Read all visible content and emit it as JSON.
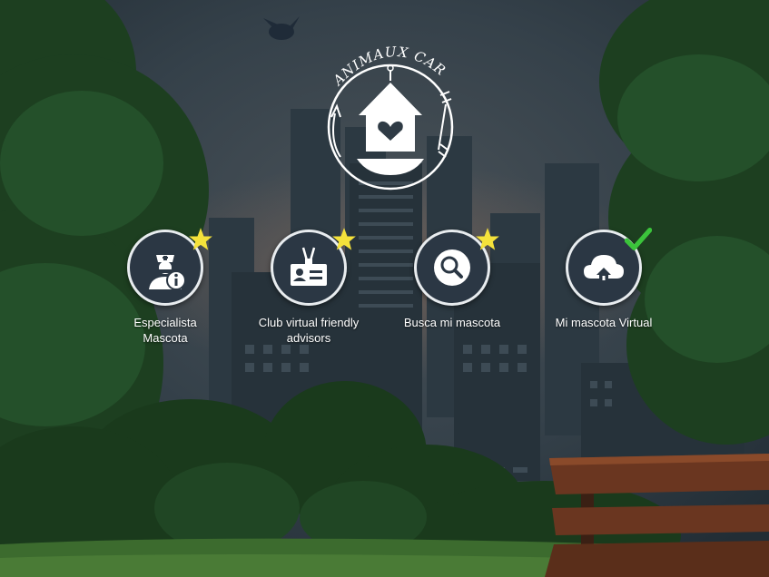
{
  "app": {
    "brand_name": "ANIMAUX CARES",
    "accent_colors": {
      "sky": "#2f3b45",
      "foliage": "#1f4a24",
      "icon_circle": "#2b3744",
      "star": "#f5e23b",
      "check": "#3bc43b"
    }
  },
  "menu": [
    {
      "label": "Especialista\nMascota",
      "icon": "vet-info-icon",
      "badge": "star-icon"
    },
    {
      "label": "Club virtual friendly\nadvisors",
      "icon": "id-card-icon",
      "badge": "star-icon"
    },
    {
      "label": "Busca mi mascota",
      "icon": "search-icon",
      "badge": "star-icon"
    },
    {
      "label": "Mi mascota Virtual",
      "icon": "cloud-home-icon",
      "badge": "checkmark-icon"
    }
  ]
}
